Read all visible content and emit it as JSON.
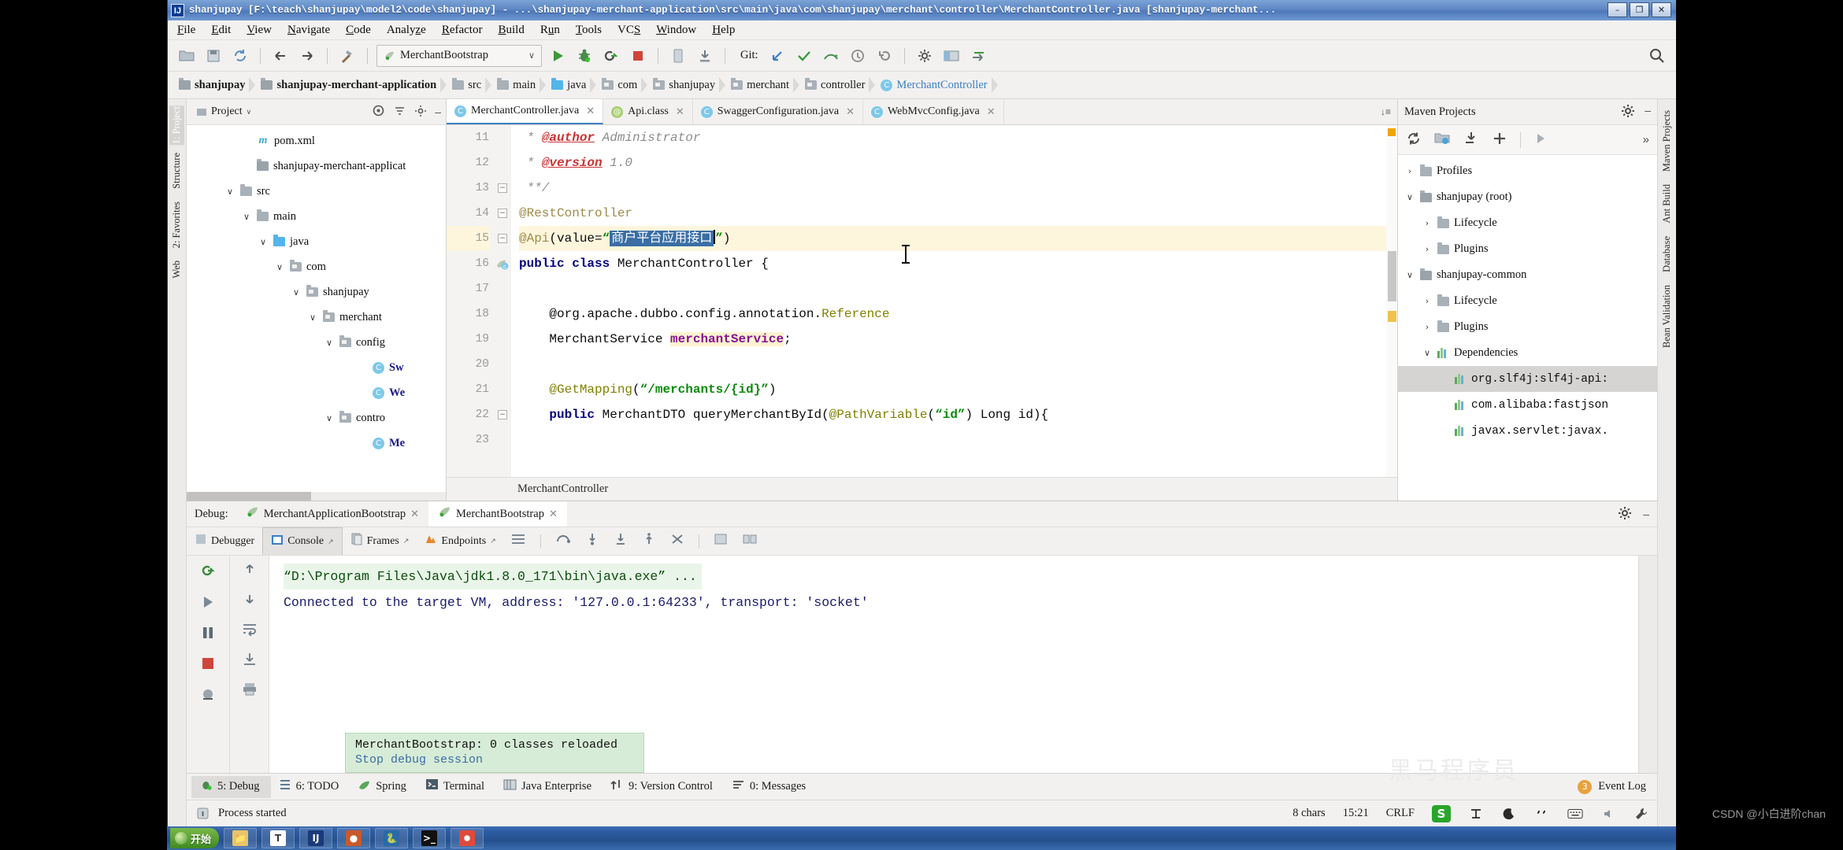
{
  "window": {
    "title": "shanjupay [F:\\teach\\shanjupay\\model2\\code\\shanjupay] - ...\\shanjupay-merchant-application\\src\\main\\java\\com\\shanjupay\\merchant\\controller\\MerchantController.java [shanjupay-merchant...",
    "app_icon": "IJ",
    "minimize": "–",
    "restore": "❐",
    "close": "✕"
  },
  "menu": {
    "items": [
      "File",
      "Edit",
      "View",
      "Navigate",
      "Code",
      "Analyze",
      "Refactor",
      "Build",
      "Run",
      "Tools",
      "VCS",
      "Window",
      "Help"
    ]
  },
  "toolbar": {
    "icons": [
      "back-arrow",
      "forward-arrow",
      "sync-icon",
      "build-hammer-icon"
    ],
    "run_config": "MerchantBootstrap",
    "run_config_arrow": "∨",
    "run_label": "run-icon",
    "debug_label": "debug-icon",
    "rerun_label": "rerun-icon",
    "stop_label": "stop-icon",
    "git_label": "Git:",
    "search_icon": "search-icon"
  },
  "breadcrumbs": [
    {
      "label": "shanjupay",
      "icon": "module-icon",
      "bold": true
    },
    {
      "label": "shanjupay-merchant-application",
      "icon": "module-icon",
      "bold": true
    },
    {
      "label": "src",
      "icon": "folder-icon",
      "bold": false
    },
    {
      "label": "main",
      "icon": "folder-icon",
      "bold": false
    },
    {
      "label": "java",
      "icon": "source-folder-icon",
      "bold": false
    },
    {
      "label": "com",
      "icon": "package-icon",
      "bold": false
    },
    {
      "label": "shanjupay",
      "icon": "package-icon",
      "bold": false
    },
    {
      "label": "merchant",
      "icon": "package-icon",
      "bold": false
    },
    {
      "label": "controller",
      "icon": "package-icon",
      "bold": false
    },
    {
      "label": "MerchantController",
      "icon": "class-icon",
      "bold": false,
      "blue": true
    }
  ],
  "left_strips": [
    "1: Project",
    "2: Favorites",
    "Structure",
    "Web"
  ],
  "right_strips": [
    "Maven Projects",
    "Ant Build",
    "Database",
    "Bean Validation"
  ],
  "project_panel": {
    "tab": "Project",
    "tab_arrow": "∨",
    "header_icons": [
      "target-icon",
      "collapse-all-icon",
      "settings-icon",
      "minimize-icon"
    ],
    "tree": [
      {
        "label": "pom.xml",
        "indent": 3,
        "icon": "maven-file-icon",
        "toggle": ""
      },
      {
        "label": "shanjupay-merchant-applicat",
        "indent": 3,
        "icon": "module-icon",
        "toggle": ""
      },
      {
        "label": "src",
        "indent": 2,
        "icon": "folder-icon",
        "toggle": "∨"
      },
      {
        "label": "main",
        "indent": 3,
        "icon": "folder-icon",
        "toggle": "∨"
      },
      {
        "label": "java",
        "indent": 4,
        "icon": "source-folder-icon",
        "toggle": "∨"
      },
      {
        "label": "com",
        "indent": 5,
        "icon": "package-icon",
        "toggle": "∨"
      },
      {
        "label": "shanjupay",
        "indent": 6,
        "icon": "package-icon",
        "toggle": "∨"
      },
      {
        "label": "merchant",
        "indent": 7,
        "icon": "package-icon",
        "toggle": "∨"
      },
      {
        "label": "config",
        "indent": 8,
        "icon": "package-icon",
        "toggle": "∨"
      },
      {
        "label": "Sw",
        "indent": 10,
        "icon": "class-icon",
        "toggle": ""
      },
      {
        "label": "We",
        "indent": 10,
        "icon": "class-icon",
        "toggle": ""
      },
      {
        "label": "contro",
        "indent": 8,
        "icon": "package-icon",
        "toggle": "∨"
      },
      {
        "label": "Me",
        "indent": 10,
        "icon": "class-icon",
        "toggle": ""
      }
    ]
  },
  "editor": {
    "tabs": [
      {
        "label": "MerchantController.java",
        "icon": "class-icon",
        "active": true,
        "close": "✕"
      },
      {
        "label": "Api.class",
        "icon": "annotation-icon",
        "active": false,
        "close": "✕"
      },
      {
        "label": "SwaggerConfiguration.java",
        "icon": "class-icon",
        "active": false,
        "close": "✕"
      },
      {
        "label": "WebMvcConfig.java",
        "icon": "class-icon",
        "active": false,
        "close": "✕"
      }
    ],
    "tabs_overflow": "↓≡",
    "breadcrumb": "MerchantController",
    "first_line_number": 11,
    "lines": [
      {
        "n": 11,
        "segments": [
          {
            "t": " * ",
            "c": "cmt"
          },
          {
            "t": "@author",
            "c": "tag"
          },
          {
            "t": " Administrator",
            "c": "cmt"
          }
        ]
      },
      {
        "n": 12,
        "segments": [
          {
            "t": " * ",
            "c": "cmt"
          },
          {
            "t": "@version",
            "c": "tag"
          },
          {
            "t": " 1.0",
            "c": "cmt"
          }
        ]
      },
      {
        "n": 13,
        "segments": [
          {
            "t": " **/",
            "c": "cmt"
          }
        ],
        "fold": true
      },
      {
        "n": 14,
        "segments": [
          {
            "t": "@RestController",
            "c": "ann"
          }
        ],
        "fold": true
      },
      {
        "n": 15,
        "highlight": true,
        "fold": true,
        "segments": [
          {
            "t": "@Api",
            "c": "ann"
          },
          {
            "t": "(value=",
            "c": ""
          },
          {
            "t": "“",
            "c": "str"
          },
          {
            "t": "商户平台应用接口",
            "c": "sel"
          },
          {
            "t": "”",
            "c": "str"
          },
          {
            "t": ")",
            "c": ""
          }
        ]
      },
      {
        "n": 16,
        "gutter_icon": "class-run-icon",
        "segments": [
          {
            "t": "public class ",
            "c": "kw"
          },
          {
            "t": "MerchantController {",
            "c": ""
          }
        ]
      },
      {
        "n": 17,
        "segments": [
          {
            "t": "",
            "c": ""
          }
        ]
      },
      {
        "n": 18,
        "segments": [
          {
            "t": "    @org.apache.dubbo.config.annotation.",
            "c": ""
          },
          {
            "t": "Reference",
            "c": "ann2"
          }
        ]
      },
      {
        "n": 19,
        "segments": [
          {
            "t": "    MerchantService ",
            "c": ""
          },
          {
            "t": "merchantService",
            "c": "fld"
          },
          {
            "t": ";",
            "c": ""
          }
        ]
      },
      {
        "n": 20,
        "segments": [
          {
            "t": "",
            "c": ""
          }
        ]
      },
      {
        "n": 21,
        "segments": [
          {
            "t": "    @GetMapping",
            "c": "ann2"
          },
          {
            "t": "(",
            "c": ""
          },
          {
            "t": "“/merchants/{id}”",
            "c": "str"
          },
          {
            "t": ")",
            "c": ""
          }
        ]
      },
      {
        "n": 22,
        "fold": true,
        "segments": [
          {
            "t": "    public ",
            "c": "kw"
          },
          {
            "t": "MerchantDTO queryMerchantById(",
            "c": ""
          },
          {
            "t": "@PathVariable",
            "c": "ann2"
          },
          {
            "t": "(",
            "c": ""
          },
          {
            "t": "“id”",
            "c": "str"
          },
          {
            "t": ") Long id){",
            "c": ""
          }
        ]
      },
      {
        "n": 23,
        "segments": [
          {
            "t": "",
            "c": ""
          }
        ]
      }
    ]
  },
  "maven_panel": {
    "title": "Maven Projects",
    "header_icons": [
      "settings-icon",
      "minimize-icon"
    ],
    "toolbar_icons": [
      "refresh-icon",
      "add-maven-project-icon",
      "download-sources-icon",
      "plus-icon",
      "run-icon",
      "more-icon"
    ],
    "tree": [
      {
        "label": "Profiles",
        "indent": 0,
        "toggle": "›",
        "icon": "profiles-icon"
      },
      {
        "label": "shanjupay (root)",
        "indent": 0,
        "toggle": "∨",
        "icon": "maven-module-icon"
      },
      {
        "label": "Lifecycle",
        "indent": 1,
        "toggle": "›",
        "icon": "lifecycle-icon"
      },
      {
        "label": "Plugins",
        "indent": 1,
        "toggle": "›",
        "icon": "plugins-icon"
      },
      {
        "label": "shanjupay-common",
        "indent": 0,
        "toggle": "∨",
        "icon": "maven-module-icon"
      },
      {
        "label": "Lifecycle",
        "indent": 1,
        "toggle": "›",
        "icon": "lifecycle-icon"
      },
      {
        "label": "Plugins",
        "indent": 1,
        "toggle": "›",
        "icon": "plugins-icon"
      },
      {
        "label": "Dependencies",
        "indent": 1,
        "toggle": "∨",
        "icon": "dependencies-icon"
      },
      {
        "label": "org.slf4j:slf4j-api:",
        "indent": 2,
        "toggle": "",
        "icon": "dependency-icon",
        "selected": true
      },
      {
        "label": "com.alibaba:fastjson",
        "indent": 2,
        "toggle": "",
        "icon": "dependency-icon"
      },
      {
        "label": "javax.servlet:javax.",
        "indent": 2,
        "toggle": "",
        "icon": "dependency-icon"
      }
    ]
  },
  "debug_panel": {
    "label": "Debug:",
    "session_tabs": [
      {
        "label": "MerchantApplicationBootstrap",
        "active": false,
        "close": "✕"
      },
      {
        "label": "MerchantBootstrap",
        "active": true,
        "close": "✕"
      }
    ],
    "header_icons": [
      "settings-icon",
      "minimize-icon"
    ],
    "sub_tabs": [
      {
        "label": "Debugger",
        "icon": "debugger-icon",
        "active": false,
        "pin": ""
      },
      {
        "label": "Console",
        "icon": "console-icon",
        "active": true,
        "pin": "↗"
      },
      {
        "label": "Frames",
        "icon": "frames-icon",
        "active": false,
        "pin": "↗"
      },
      {
        "label": "Endpoints",
        "icon": "endpoints-icon",
        "active": false,
        "pin": "↗"
      }
    ],
    "sub_toolbar_icons": [
      "layout-icon",
      "step-over-icon",
      "step-into-icon",
      "force-step-into-icon",
      "step-out-icon",
      "drop-frame-icon",
      "evaluate-icon",
      "mute-breakpoints-icon"
    ],
    "left_icons": [
      "rerun-icon",
      "resume-icon",
      "pause-icon",
      "stop-icon"
    ],
    "left2_icons": [
      "up-icon",
      "down-icon",
      "soft-wrap-icon",
      "scroll-end-icon",
      "print-icon"
    ],
    "console_lines": [
      {
        "text": "“D:\\Program Files\\Java\\jdk1.8.0_171\\bin\\java.exe” ...",
        "style": "cmd"
      },
      {
        "text": "Connected to the target VM, address: '127.0.0.1:64233', transport: 'socket'",
        "style": "conn"
      }
    ]
  },
  "notification": {
    "line1": "MerchantBootstrap: 0 classes reloaded",
    "line2": "Stop debug session"
  },
  "tool_windows": {
    "items": [
      {
        "label": "5: Debug",
        "icon": "debug-icon",
        "selected": true
      },
      {
        "label": "6: TODO",
        "icon": "todo-icon",
        "selected": false
      },
      {
        "label": "Spring",
        "icon": "spring-icon",
        "selected": false
      },
      {
        "label": "Terminal",
        "icon": "terminal-icon",
        "selected": false
      },
      {
        "label": "Java Enterprise",
        "icon": "java-ee-icon",
        "selected": false
      },
      {
        "label": "9: Version Control",
        "icon": "vcs-icon",
        "selected": false
      },
      {
        "label": "0: Messages",
        "icon": "messages-icon",
        "selected": false
      }
    ],
    "event_log": "Event Log",
    "event_count": "3"
  },
  "status_bar": {
    "message": "Process started",
    "chars": "8 chars",
    "position": "15:21",
    "line_sep": "CRLF",
    "ime": "S",
    "icons": [
      "ime-full-width-icon",
      "ime-moon-icon",
      "ime-punct-icon",
      "keyboard-icon",
      "sound-icon",
      "wrench-icon"
    ]
  },
  "taskbar": {
    "start": "开始",
    "items": [
      "explorer-icon",
      "text-editor-icon",
      "intellij-icon",
      "app-icon",
      "python-icon",
      "cmd-icon",
      "chrome-icon"
    ]
  },
  "watermark": "黑马程序员",
  "credit": "CSDN @小白进阶chan",
  "colors": {
    "accent": "#3e7fc4",
    "selection": "#3a6ea5",
    "highlight_line": "#fdf6dd",
    "keyword": "#000080",
    "string": "#0a8a0a",
    "field": "#871094",
    "annotation": "#808000"
  }
}
